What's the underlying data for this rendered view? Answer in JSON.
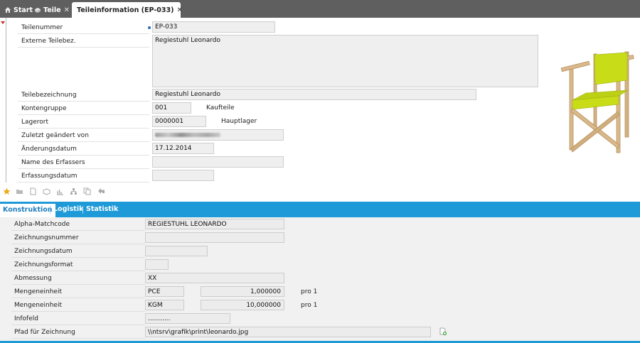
{
  "tabs": [
    {
      "label": "Start",
      "icon": "home-icon"
    },
    {
      "label": "Teile",
      "icon": "parts-icon",
      "close": "✕"
    },
    {
      "label": "Teileinformation (EP-033)",
      "icon": "part-info-icon",
      "close": "✕",
      "active": true
    }
  ],
  "upper": {
    "teilenummer_label": "Teilenummer",
    "teilenummer_value": "EP-033",
    "externe_label": "Externe Teilebez.",
    "externe_value": "Regiestuhl Leonardo",
    "teilebez_label": "Teilebezeichnung",
    "teilebez_value": "Regiestuhl Leonardo",
    "kontengruppe_label": "Kontengruppe",
    "kontengruppe_value": "001",
    "kontengruppe_desc": "Kaufteile",
    "lagerort_label": "Lagerort",
    "lagerort_value": "0000001",
    "lagerort_desc": "Hauptlager",
    "zuletzt_label": "Zuletzt geändert von",
    "aenderung_label": "Änderungsdatum",
    "aenderung_value": "17.12.2014",
    "erfasser_label": "Name des Erfassers",
    "erfassung_label": "Erfassungsdatum"
  },
  "tool_icons": [
    "star-icon",
    "folder-icon",
    "document-icon",
    "box-icon",
    "chart-icon",
    "network-icon",
    "copy-icon",
    "undo-icon"
  ],
  "subtabs": [
    {
      "label": "Konstruktion",
      "active": true
    },
    {
      "label": "Logistik"
    },
    {
      "label": "Statistik"
    }
  ],
  "lower": {
    "alpha_label": "Alpha-Matchcode",
    "alpha_value": "REGIESTUHL LEONARDO",
    "znr_label": "Zeichnungsnummer",
    "zdatum_label": "Zeichnungsdatum",
    "zformat_label": "Zeichnungsformat",
    "abmessung_label": "Abmessung",
    "abmessung_value": "XX",
    "me1_label": "Mengeneinheit",
    "me1_unit": "PCE",
    "me1_qty": "1,000000",
    "me1_per": "pro 1",
    "me2_label": "Mengeneinheit",
    "me2_unit": "KGM",
    "me2_qty": "10,000000",
    "me2_per": "pro 1",
    "infofeld_label": "Infofeld",
    "infofeld_value": "...........",
    "pfad_label": "Pfad für Zeichnung",
    "pfad_value": "\\\\ntsrv\\grafik\\print\\leonardo.jpg"
  },
  "colors": {
    "tabbar": "#5f5f5f",
    "accent": "#1e9ad8",
    "chair_fabric": "#c8dc18",
    "chair_wood": "#d9b98c"
  }
}
